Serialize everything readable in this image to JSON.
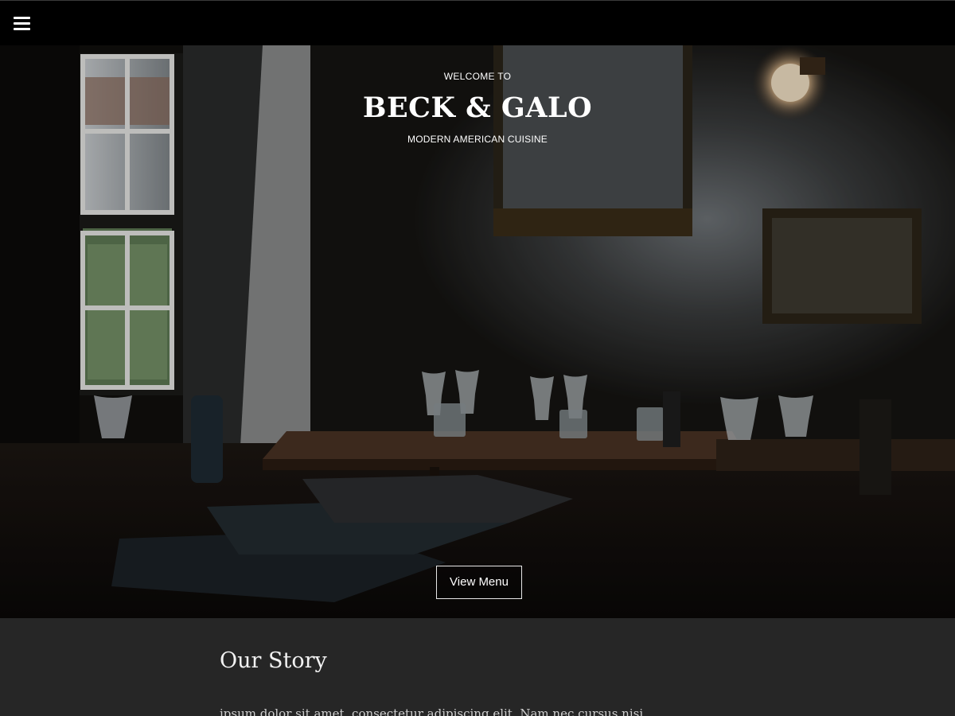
{
  "topbar": {
    "menu_icon": "hamburger-menu-icon"
  },
  "hero": {
    "welcome": "WELCOME TO",
    "brand": "BECK & GALO",
    "tagline": "MODERN AMERICAN CUISINE",
    "cta_label": "View Menu",
    "image_description": "dimly lit restaurant interior with window, wall mirror, lamp and set tables"
  },
  "story": {
    "title": "Our Story",
    "text": "ipsum dolor sit amet, consectetur adipiscing elit. Nam nec cursus nisi"
  },
  "colors": {
    "topbar": "#000000",
    "story_bg": "#262626",
    "text": "#ffffff"
  }
}
